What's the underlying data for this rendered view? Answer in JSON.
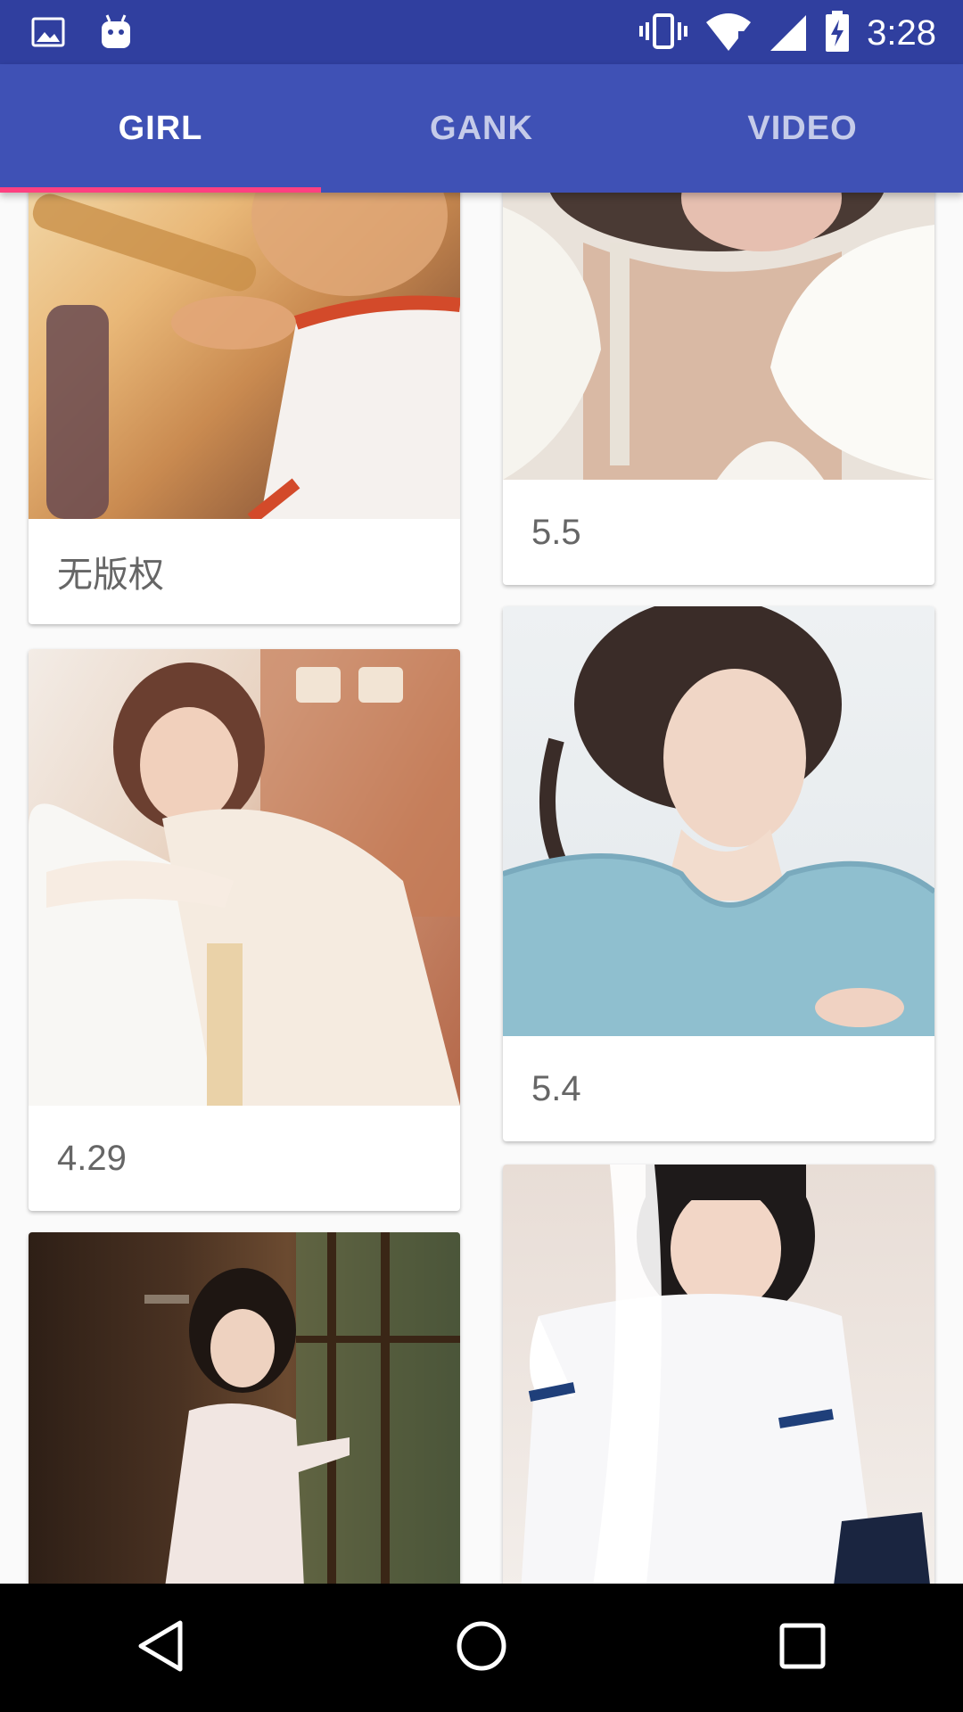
{
  "status_bar": {
    "time": "3:28",
    "icons": [
      "image-icon",
      "android-icon",
      "vibrate-icon",
      "wifi-icon",
      "signal-icon",
      "battery-charging-icon"
    ]
  },
  "tabs": [
    {
      "label": "GIRL",
      "active": true
    },
    {
      "label": "GANK",
      "active": false
    },
    {
      "label": "VIDEO",
      "active": false
    }
  ],
  "cards": [
    {
      "label": "无版权",
      "photo": "girl-railing-photo"
    },
    {
      "label": "5.5",
      "photo": "girl-fur-photo"
    },
    {
      "label": "4.29",
      "photo": "girl-leaning-photo"
    },
    {
      "label": "5.4",
      "photo": "girl-blue-sweater-photo"
    },
    {
      "label": "",
      "photo": "girl-window-photo"
    },
    {
      "label": "",
      "photo": "girl-uniform-photo"
    }
  ],
  "nav": {
    "back": "back-icon",
    "home": "home-icon",
    "recents": "recents-icon"
  },
  "colors": {
    "primary": "#3f51b5",
    "primary_dark": "#303f9f",
    "accent": "#ff4081"
  }
}
